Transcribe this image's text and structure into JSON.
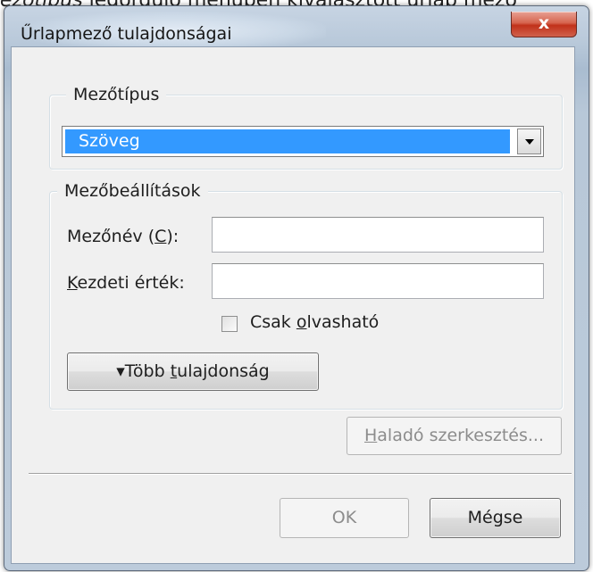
{
  "background_text": {
    "prefix": "ezőtípus",
    "rest": " legördülő menüben kiválasztott űrlap mező"
  },
  "window": {
    "title": "Űrlapmező tulajdonságai",
    "close_glyph": "x"
  },
  "field_type_group": {
    "legend": "Mezőtípus",
    "selected_value": "Szöveg"
  },
  "field_settings_group": {
    "legend": "Mezőbeállítások",
    "name_label_prefix": "Mezőnév (",
    "name_label_key": "C",
    "name_label_suffix": "):",
    "name_value": "",
    "initial_label_key": "K",
    "initial_label_rest": "ezdeti érték:",
    "initial_value": "",
    "readonly_prefix": "Csak ",
    "readonly_key": "o",
    "readonly_rest": "lvasható",
    "readonly_checked": false,
    "more_button_arrow": "▾",
    "more_button_prefix": "Több ",
    "more_button_key": "t",
    "more_button_rest": "ulajdonság"
  },
  "advanced_button": {
    "key": "H",
    "rest": "aladó szerkesztés..."
  },
  "footer": {
    "ok_label": "OK",
    "cancel_label": "Mégse"
  }
}
